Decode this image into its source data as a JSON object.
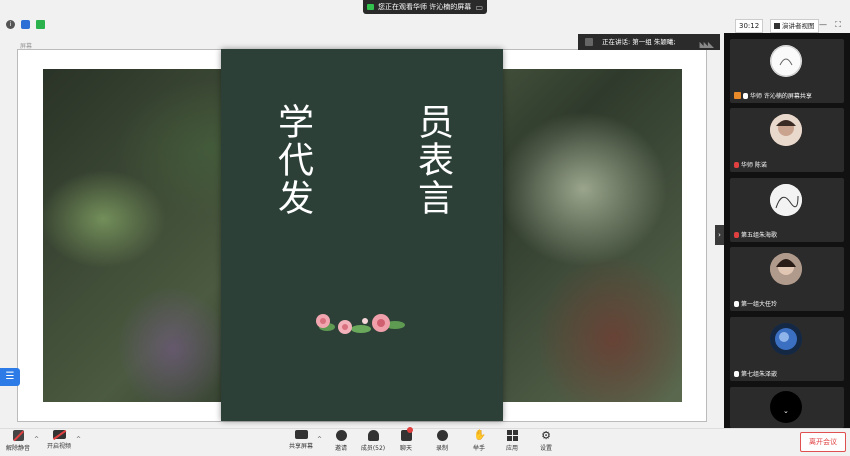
{
  "banner": {
    "text": "您正在观看华师 许沁楠的屏幕",
    "menu_icon": "more-icon"
  },
  "status": {
    "timer": "30:12",
    "view_label": "演讲者视图"
  },
  "share": {
    "sharer_label": "屏幕",
    "slide": {
      "left_text": "学代发",
      "right_text": "员表言"
    }
  },
  "speaking": {
    "text": "正在讲话: 第一组 朱颖曦;"
  },
  "participants": [
    {
      "name": "华师 许沁楠的屏幕共享",
      "muted": false,
      "host_badge": true
    },
    {
      "name": "华师 陈诺",
      "muted": true,
      "host_badge": false
    },
    {
      "name": "第五组朱海歌",
      "muted": true,
      "host_badge": false
    },
    {
      "name": "第一组大任玲",
      "muted": false,
      "host_badge": false
    },
    {
      "name": "第七组朱泽嵌",
      "muted": false,
      "host_badge": false
    }
  ],
  "toolbar": {
    "mute_label": "解除静音",
    "video_label": "开启视频",
    "share_label": "共享屏幕",
    "invite_label": "邀请",
    "members_label": "成员(52)",
    "chat_label": "聊天",
    "record_label": "录制",
    "raise_label": "举手",
    "apps_label": "应用",
    "settings_label": "设置",
    "leave_label": "离开会议"
  },
  "colors": {
    "slide_bg": "#2c4038",
    "accent": "#2d7be6",
    "leave": "#e04040"
  }
}
